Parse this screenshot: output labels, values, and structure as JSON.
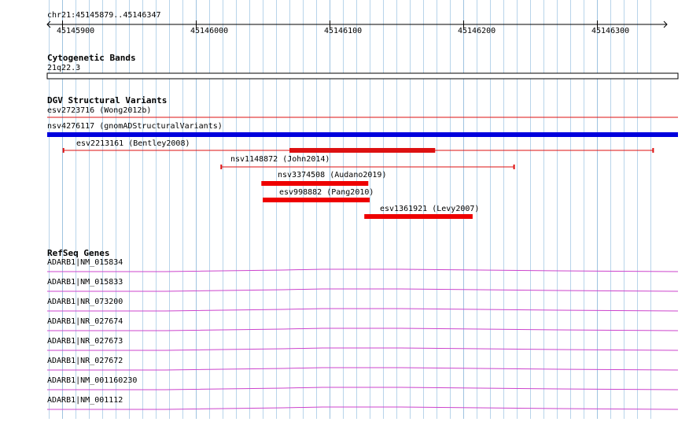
{
  "ruler": {
    "region": "chr21:45145879..45146347",
    "ticks": [
      "45145900",
      "45146000",
      "45146100",
      "45146200",
      "45146300"
    ]
  },
  "cytoband": {
    "title": "Cytogenetic Bands",
    "band": "21q22.3"
  },
  "dgv": {
    "title": "DGV Structural Variants",
    "features": [
      {
        "label": "esv2723716 (Wong2012b)",
        "start": 45145879,
        "end": 45146347,
        "style": "thin",
        "color": "#dd1111"
      },
      {
        "label": "nsv4276117 (gnomADStructuralVariants)",
        "start": 45145879,
        "end": 45146347,
        "style": "thick",
        "color": "#0000dd"
      },
      {
        "label": "esv2213161 (Bentley2008)",
        "start": 45145901,
        "end": 45146342,
        "inner_start": 45146070,
        "inner_end": 45146179,
        "style": "bracket",
        "color": "#dd1111"
      },
      {
        "label": "nsv1148872 (John2014)",
        "start": 45146019,
        "end": 45146238,
        "style": "bracket",
        "color": "#dd1111"
      },
      {
        "label": "nsv3374508 (Audano2019)",
        "start": 45146049,
        "end": 45146129,
        "style": "block",
        "color": "#ee0000"
      },
      {
        "label": "esv998882 (Pang2010)",
        "start": 45146050,
        "end": 45146130,
        "style": "block",
        "color": "#ee0000"
      },
      {
        "label": "esv1361921 (Levy2007)",
        "start": 45146126,
        "end": 45146207,
        "style": "block",
        "color": "#ee0000"
      }
    ]
  },
  "refseq": {
    "title": "RefSeq Genes",
    "genes": [
      "ADARB1|NM_015834",
      "ADARB1|NM_015833",
      "ADARB1|NR_073200",
      "ADARB1|NR_027674",
      "ADARB1|NR_027673",
      "ADARB1|NR_027672",
      "ADARB1|NM_001160230",
      "ADARB1|NM_001112"
    ],
    "intron_color": "#cc44cc"
  },
  "colors": {
    "grid": "#b8d4ea",
    "grid_major": "#9fc3e0"
  }
}
